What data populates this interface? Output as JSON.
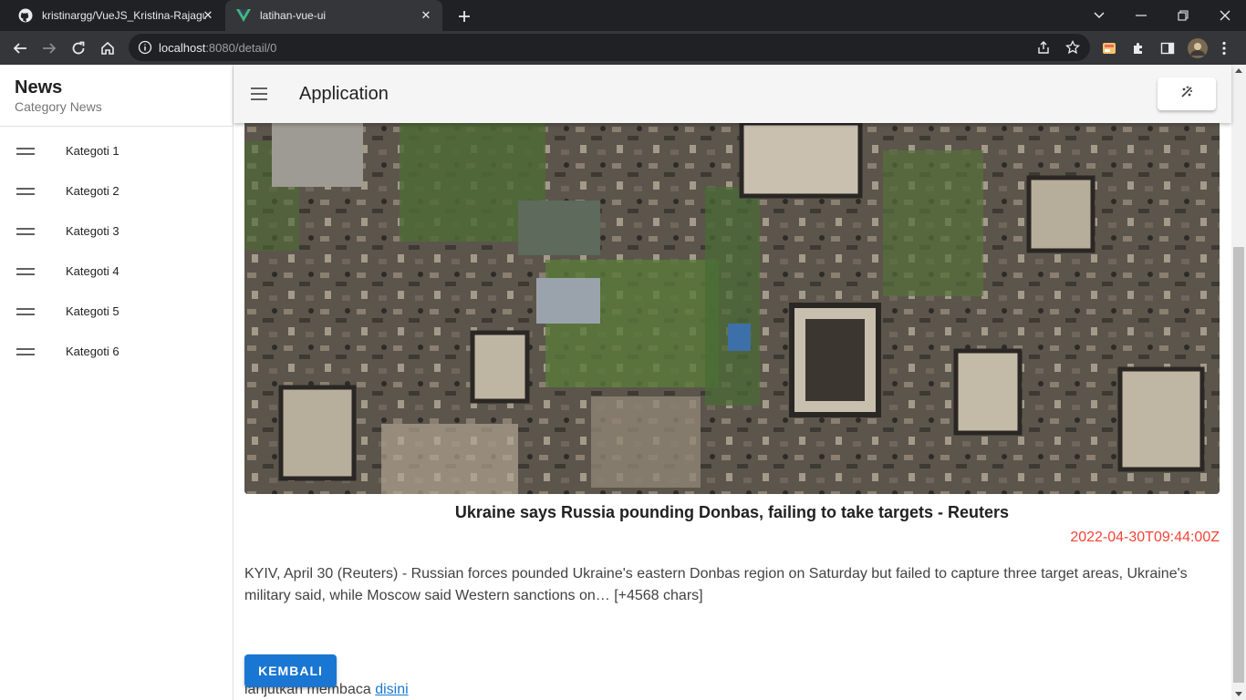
{
  "browser": {
    "tabs": [
      {
        "title": "kristinargg/VueJS_Kristina-Rajagukguk",
        "favicon": "github-icon"
      },
      {
        "title": "latihan-vue-ui",
        "favicon": "vue-icon"
      }
    ],
    "address": {
      "host": "localhost",
      "rest": ":8080/detail/0"
    }
  },
  "drawer": {
    "title": "News",
    "subtitle": "Category News",
    "items": [
      {
        "label": "Kategoti 1"
      },
      {
        "label": "Kategoti 2"
      },
      {
        "label": "Kategoti 3"
      },
      {
        "label": "Kategoti 4"
      },
      {
        "label": "Kategoti 5"
      },
      {
        "label": "Kategoti 6"
      }
    ]
  },
  "appbar": {
    "title": "Application"
  },
  "article": {
    "headline": "Ukraine says Russia pounding Donbas, failing to take targets - Reuters",
    "published": "2022-04-30T09:44:00Z",
    "description": "KYIV, April 30 (Reuters) - Russian forces pounded Ukraine's eastern Donbas region on Saturday but failed to capture three target areas, Ukraine's military said, while Moscow said Western sanctions on… [+4568 chars]",
    "more_prefix": "lanjutkan membaca",
    "more_link": "disini",
    "back_label": "KEMBALI"
  },
  "colors": {
    "primary": "#1976d2",
    "date": "#f44336",
    "tabbar": "#202124",
    "toolbar": "#35363a"
  }
}
